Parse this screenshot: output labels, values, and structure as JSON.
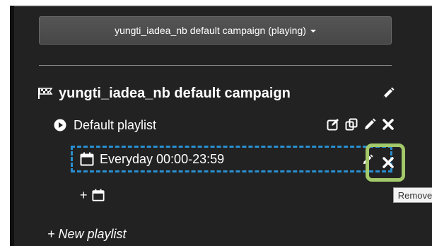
{
  "campaign_selector": {
    "label": "yungti_iadea_nb default campaign (playing)"
  },
  "campaign": {
    "title": "yungti_iadea_nb default campaign"
  },
  "playlist": {
    "title": "Default playlist"
  },
  "schedule": {
    "title": "Everyday 00:00-23:59"
  },
  "tooltip": {
    "text": "Remove"
  },
  "add_schedule": {
    "label": "+"
  },
  "new_playlist": {
    "label": "+ New playlist"
  },
  "colors": {
    "panel_bg": "#222222",
    "highlight_dashed": "#2a8fd0",
    "callout_green": "#a3c96a"
  }
}
